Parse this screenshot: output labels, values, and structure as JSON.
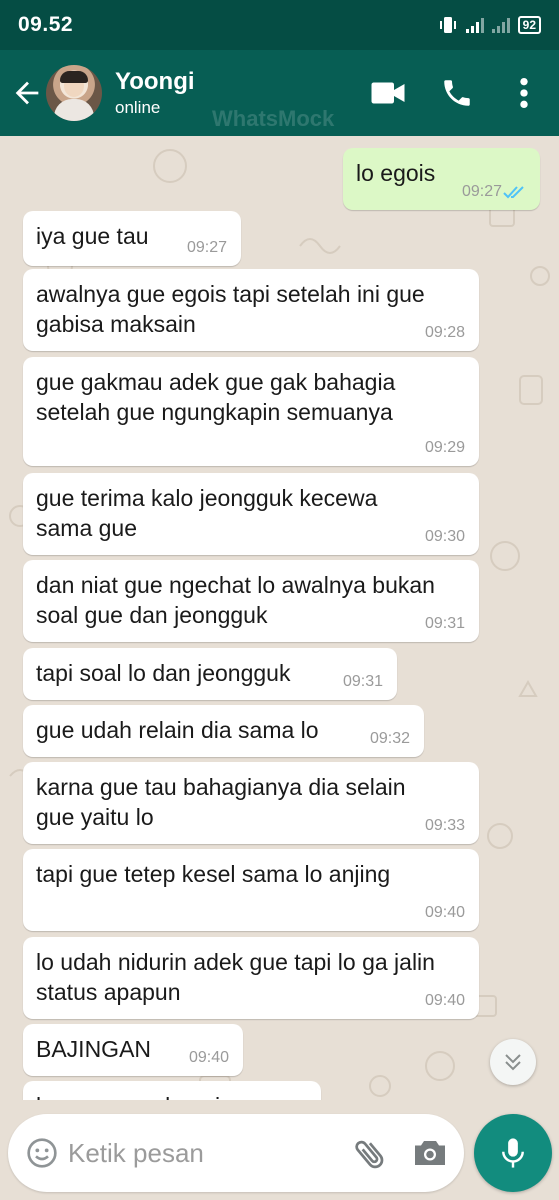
{
  "status_bar": {
    "time": "09.52",
    "battery": "92"
  },
  "header": {
    "contact_name": "Yoongi",
    "contact_status": "online",
    "watermark": "WhatsMock",
    "icons": [
      "back-arrow-icon",
      "video-call-icon",
      "voice-call-icon",
      "more-options-icon"
    ]
  },
  "messages": [
    {
      "direction": "out",
      "text": "lo egois",
      "time": "09:27",
      "status": "read"
    },
    {
      "direction": "in",
      "text": "iya gue tau",
      "time": "09:27"
    },
    {
      "direction": "in",
      "text": "awalnya gue egois tapi setelah ini gue\ngabisa maksain",
      "time": "09:28"
    },
    {
      "direction": "in",
      "text": "gue gakmau adek gue gak bahagia\nsetelah gue ngungkapin semuanya",
      "time": "09:29"
    },
    {
      "direction": "in",
      "text": "gue terima kalo jeongguk kecewa\nsama gue",
      "time": "09:30"
    },
    {
      "direction": "in",
      "text": "dan niat gue ngechat lo awalnya bukan\nsoal gue dan jeongguk",
      "time": "09:31"
    },
    {
      "direction": "in",
      "text": "tapi soal lo dan jeongguk",
      "time": "09:31"
    },
    {
      "direction": "in",
      "text": "gue udah relain dia sama lo",
      "time": "09:32"
    },
    {
      "direction": "in",
      "text": "karna gue tau bahagianya dia selain\ngue yaitu lo",
      "time": "09:33"
    },
    {
      "direction": "in",
      "text": "tapi gue tetep kesel sama lo anjing",
      "time": "09:40"
    },
    {
      "direction": "in",
      "text": "lo udah nidurin adek gue tapi lo ga jalin\nstatus apapun",
      "time": "09:40"
    },
    {
      "direction": "in",
      "text": "BAJINGAN",
      "time": "09:40"
    },
    {
      "direction": "in",
      "text": "lo cowo apa banci",
      "time": ""
    }
  ],
  "composer": {
    "placeholder": "Ketik pesan",
    "icons": [
      "emoji-icon",
      "attach-icon",
      "camera-icon",
      "mic-icon"
    ]
  },
  "colors": {
    "header": "#075e54",
    "status_bar": "#054d44",
    "incoming_bubble": "#ffffff",
    "outgoing_bubble": "#dcf8c6",
    "chat_background": "#e7dfd5",
    "read_ticks": "#4fc3f7",
    "fab": "#128c7e"
  }
}
